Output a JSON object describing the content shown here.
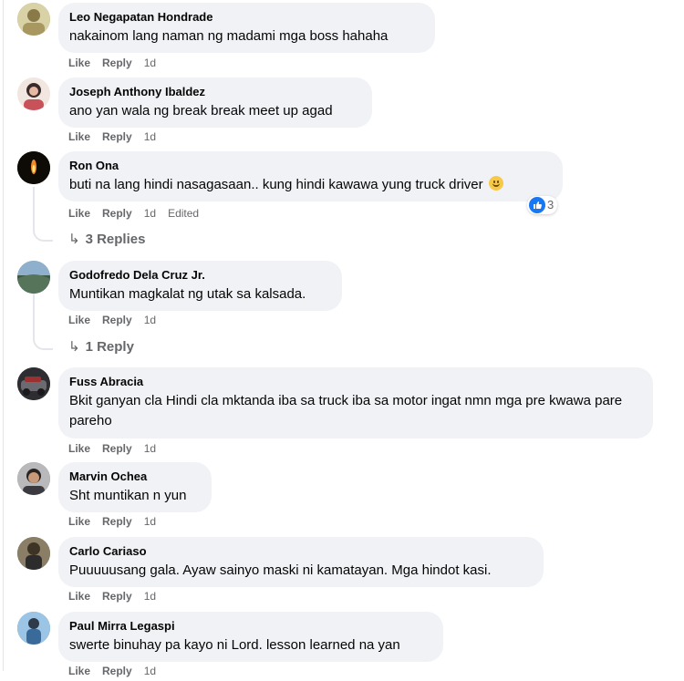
{
  "actions": {
    "like": "Like",
    "reply": "Reply"
  },
  "comments": [
    {
      "author": "Leo Negapatan Hondrade",
      "text": "nakainom lang naman ng madami mga boss hahaha",
      "time": "1d",
      "avatar_color": "#b7ab72"
    },
    {
      "author": "Joseph Anthony Ibaldez",
      "text": "ano yan wala ng break break meet up agad",
      "time": "1d",
      "avatar_color": "#c9525a"
    },
    {
      "author": "Ron Ona",
      "text": "buti na lang hindi nasagasaan.. kung hindi kawawa yung truck driver",
      "time": "1d",
      "edited": "Edited",
      "reaction_count": "3",
      "replies": "3 Replies",
      "avatar_color": "#1a1208"
    },
    {
      "author": "Godofredo Dela Cruz Jr.",
      "text": "Muntikan magkalat ng utak sa kalsada.",
      "time": "1d",
      "replies": "1 Reply",
      "avatar_color": "#6f8fa8"
    },
    {
      "author": "Fuss Abracia",
      "text": "Bkit ganyan cla Hindi cla mktanda iba sa truck iba sa motor ingat nmn mga pre kwawa pare pareho",
      "time": "1d",
      "avatar_color": "#3b3b3f"
    },
    {
      "author": "Marvin Ochea",
      "text": "Sht muntikan n yun",
      "time": "1d",
      "avatar_color": "#7d7d80"
    },
    {
      "author": "Carlo Cariaso",
      "text": "Puuuuusang gala. Ayaw sainyo maski ni kamatayan. Mga hindot kasi.",
      "time": "1d",
      "avatar_color": "#6e6350"
    },
    {
      "author": "Paul Mirra Legaspi",
      "text": "swerte binuhay pa kayo ni Lord. lesson learned na yan",
      "time": "1d",
      "avatar_color": "#4d7fb0"
    }
  ]
}
